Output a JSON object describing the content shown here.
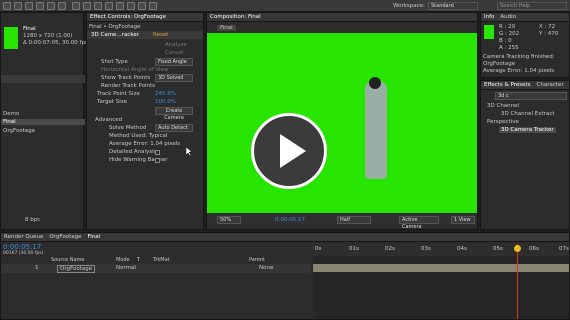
{
  "toolbar": {
    "workspace_label": "Workspace:",
    "workspace_value": "Standard",
    "search_placeholder": "Search Help"
  },
  "project": {
    "item_name": "Final",
    "item_info1": "1280 x 720 (1.00)",
    "item_info2": "Δ 0:00:07:05, 30.00 fps",
    "list": [
      "Demo",
      "Final",
      "OrgFootage"
    ],
    "bpc": "8 bpc"
  },
  "effect_controls": {
    "tab": "Effect Controls: OrgFootage",
    "breadcrumb": "Final • OrgFootage",
    "effect_name": "3D Came...racker",
    "reset": "Reset",
    "analyze": "Analyze",
    "cancel": "Cancel",
    "shot_type_label": "Shot Type",
    "shot_type_value": "Fixed Angle",
    "hfov_label": "Horizontal Angle of View",
    "show_track_points_label": "Show Track Points",
    "show_track_points_value": "3D Solved",
    "render_track_points_label": "Render Track Points",
    "track_point_size_label": "Track Point Size",
    "track_point_size_value": "245.6%",
    "target_size_label": "Target Size",
    "target_size_value": "100.0%",
    "create_camera": "Create Camera",
    "advanced_label": "Advanced",
    "solve_method_label": "Solve Method",
    "solve_method_value": "Auto Detect",
    "method_used": "Method Used: Typical",
    "avg_error": "Average Error: 1.04 pixels",
    "detailed_analysis": "Detailed Analysis",
    "hide_warning_banner": "Hide Warning Banner"
  },
  "composition": {
    "tab": "Composition: Final",
    "sub_tab": "Final",
    "zoom": "50%",
    "timecode": "0:00:05:17",
    "quality": "Half",
    "camera": "Active Camera",
    "views": "1 View"
  },
  "info": {
    "tabs": [
      "Info",
      "Audio"
    ],
    "r": "R : 29",
    "g": "G : 202",
    "b": "B : 0",
    "a": "A : 255",
    "x": "X : 72",
    "y": "Y : 470",
    "msg1": "Camera Tracking finished:",
    "msg2": "OrgFootage",
    "msg3": "Average Error: 1.04 pixels"
  },
  "effects_presets": {
    "tabs": [
      "Effects & Presets",
      "Character"
    ],
    "search": "3d c",
    "items": [
      "3D Channel",
      "3D Channel Extract",
      "Perspective",
      "3D Camera Tracker"
    ]
  },
  "timeline": {
    "tabs": [
      "Render Queue",
      "OrgFootage",
      "Final"
    ],
    "timecode": "0:00:05:17",
    "fps": "00167 (30.00 fps)",
    "columns": [
      "Source Name",
      "Mode",
      "T",
      "TrkMat",
      "Parent"
    ],
    "layer_index": "1",
    "layer_name": "OrgFootage",
    "layer_mode": "Normal",
    "layer_parent": "None",
    "ruler": [
      "0s",
      "01s",
      "02s",
      "03s",
      "04s",
      "05s",
      "06s",
      "07s"
    ]
  },
  "colors": {
    "green_screen": "#27e500",
    "accent_blue": "#3d8ee0",
    "playhead": "#e03020"
  },
  "play_icon": "play-icon"
}
